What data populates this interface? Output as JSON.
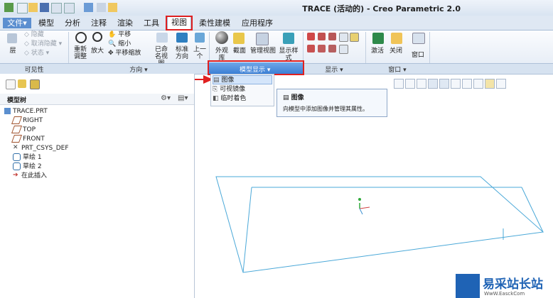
{
  "window": {
    "title": "TRACE (活动的) - Creo Parametric 2.0"
  },
  "menu": {
    "tabs": [
      "文件",
      "模型",
      "分析",
      "注释",
      "渲染",
      "工具",
      "视图",
      "柔性建模",
      "应用程序"
    ],
    "selected_tab": "视图"
  },
  "ribbon": {
    "visibility": {
      "layer": "层",
      "hide": "隐藏",
      "unhide": "取消隐藏",
      "status": "状态",
      "group_label": "可见性"
    },
    "orientation": {
      "refit": "重新调整",
      "zoom_in": "放大",
      "pan": "平移",
      "zoom_out": "缩小",
      "pan_zoom": "平移缩放",
      "named_views": "已命名视图",
      "standard_orientation": "标准方向",
      "previous": "上一个",
      "group_label": "方向"
    },
    "model_display": {
      "appearance": "外观库",
      "section": "截面",
      "view_manager": "管理视图",
      "display_style": "显示样式",
      "group_label": "模型显示"
    },
    "show": {
      "group_label": "显示"
    },
    "window": {
      "activate": "激活",
      "close": "关闭",
      "window": "窗口",
      "group_label": "窗口"
    }
  },
  "dropdown": {
    "items": [
      "图像",
      "可视镜像",
      "临时着色"
    ],
    "highlighted": "图像"
  },
  "tooltip": {
    "title": "图像",
    "description": "向模型中添加图像并管理其属性。"
  },
  "model_tree": {
    "header": "模型树",
    "items": [
      "TRACE.PRT",
      "RIGHT",
      "TOP",
      "FRONT",
      "PRT_CSYS_DEF",
      "草绘 1",
      "草绘 2",
      "在此插入"
    ]
  },
  "watermark": {
    "text": "易采站长站",
    "sub": "WwW.EasckCom"
  },
  "colors": {
    "accent": "#3b7fd5",
    "highlight_red": "#e02020",
    "sketch_line": "#4aa8d8"
  }
}
